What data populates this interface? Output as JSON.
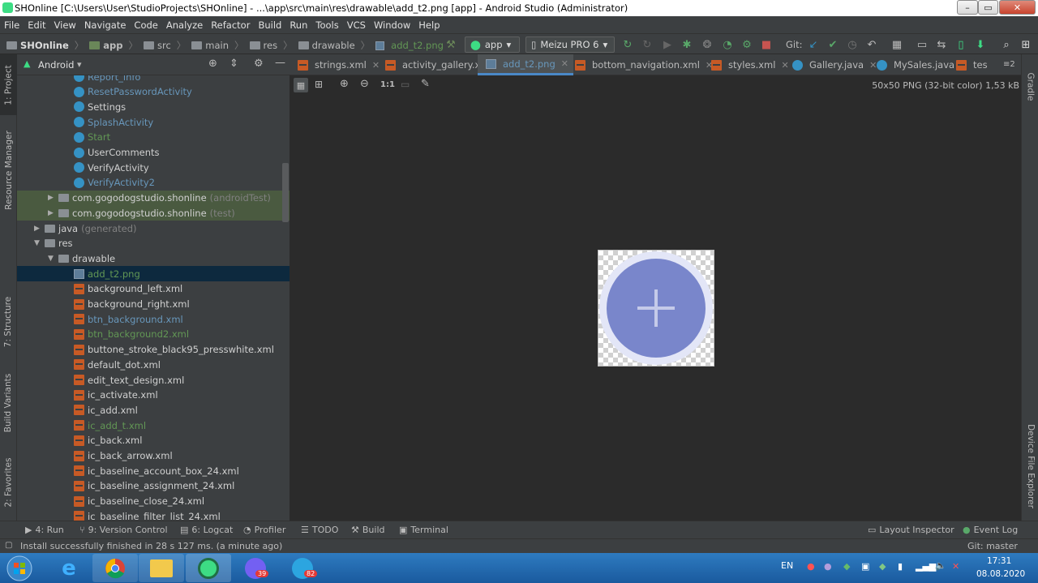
{
  "window": {
    "title": "SHOnline [C:\\Users\\User\\StudioProjects\\SHOnline] - ...\\app\\src\\main\\res\\drawable\\add_t2.png [app] - Android Studio (Administrator)"
  },
  "menu": [
    "File",
    "Edit",
    "View",
    "Navigate",
    "Code",
    "Analyze",
    "Refactor",
    "Build",
    "Run",
    "Tools",
    "VCS",
    "Window",
    "Help"
  ],
  "breadcrumb": [
    "SHOnline",
    "app",
    "src",
    "main",
    "res",
    "drawable",
    "add_t2.png"
  ],
  "toolbar": {
    "run_config": "app",
    "device": "Meizu PRO 6",
    "git_label": "Git:"
  },
  "left_strip": {
    "project": "1: Project",
    "resource_manager": "Resource Manager",
    "structure": "7: Structure",
    "build_variants": "Build Variants",
    "favorites": "2: Favorites"
  },
  "right_strip": {
    "gradle": "Gradle",
    "device_file_explorer": "Device File Explorer"
  },
  "project_panel": {
    "view_mode": "Android"
  },
  "tree": [
    {
      "label": "Report_info",
      "kind": "class",
      "indent": 70,
      "color": "c-blue"
    },
    {
      "label": "ResetPasswordActivity",
      "kind": "class",
      "indent": 70,
      "color": "c-blue"
    },
    {
      "label": "Settings",
      "kind": "class",
      "indent": 70,
      "color": "c-white"
    },
    {
      "label": "SplashActivity",
      "kind": "class",
      "indent": 70,
      "color": "c-blue"
    },
    {
      "label": "Start",
      "kind": "class",
      "indent": 70,
      "color": "c-green"
    },
    {
      "label": "UserComments",
      "kind": "class",
      "indent": 70,
      "color": "c-white"
    },
    {
      "label": "VerifyActivity",
      "kind": "class",
      "indent": 70,
      "color": "c-white"
    },
    {
      "label": "VerifyActivity2",
      "kind": "class",
      "indent": 70,
      "color": "c-blue"
    },
    {
      "label": "com.gogodogstudio.shonline",
      "suffix": "(androidTest)",
      "kind": "package",
      "indent": 36,
      "color": "c-white",
      "arrow": "▶",
      "hl": "green"
    },
    {
      "label": "com.gogodogstudio.shonline",
      "suffix": "(test)",
      "kind": "package",
      "indent": 36,
      "color": "c-white",
      "arrow": "▶",
      "hl": "green"
    },
    {
      "label": "java",
      "suffix": "(generated)",
      "kind": "folder",
      "indent": 19,
      "color": "c-white",
      "arrow": "▶"
    },
    {
      "label": "res",
      "kind": "folder",
      "indent": 19,
      "color": "c-white",
      "arrow": "▼"
    },
    {
      "label": "drawable",
      "kind": "folder",
      "indent": 36,
      "color": "c-white",
      "arrow": "▼"
    },
    {
      "label": "add_t2.png",
      "kind": "png",
      "indent": 70,
      "color": "c-green",
      "hl": "selected"
    },
    {
      "label": "background_left.xml",
      "kind": "xml",
      "indent": 70,
      "color": "c-white"
    },
    {
      "label": "background_right.xml",
      "kind": "xml",
      "indent": 70,
      "color": "c-white"
    },
    {
      "label": "btn_background.xml",
      "kind": "xml",
      "indent": 70,
      "color": "c-blue"
    },
    {
      "label": "btn_background2.xml",
      "kind": "xml",
      "indent": 70,
      "color": "c-green"
    },
    {
      "label": "buttone_stroke_black95_presswhite.xml",
      "kind": "xml",
      "indent": 70,
      "color": "c-white"
    },
    {
      "label": "default_dot.xml",
      "kind": "xml",
      "indent": 70,
      "color": "c-white"
    },
    {
      "label": "edit_text_design.xml",
      "kind": "xml",
      "indent": 70,
      "color": "c-white"
    },
    {
      "label": "ic_activate.xml",
      "kind": "xml",
      "indent": 70,
      "color": "c-white"
    },
    {
      "label": "ic_add.xml",
      "kind": "xml",
      "indent": 70,
      "color": "c-white"
    },
    {
      "label": "ic_add_t.xml",
      "kind": "xml",
      "indent": 70,
      "color": "c-green"
    },
    {
      "label": "ic_back.xml",
      "kind": "xml",
      "indent": 70,
      "color": "c-white"
    },
    {
      "label": "ic_back_arrow.xml",
      "kind": "xml",
      "indent": 70,
      "color": "c-white"
    },
    {
      "label": "ic_baseline_account_box_24.xml",
      "kind": "xml",
      "indent": 70,
      "color": "c-white"
    },
    {
      "label": "ic_baseline_assignment_24.xml",
      "kind": "xml",
      "indent": 70,
      "color": "c-white"
    },
    {
      "label": "ic_baseline_close_24.xml",
      "kind": "xml",
      "indent": 70,
      "color": "c-white"
    },
    {
      "label": "ic_baseline_filter_list_24.xml",
      "kind": "xml",
      "indent": 70,
      "color": "c-white"
    }
  ],
  "editor_tabs": [
    {
      "label": "strings.xml",
      "icon": "xml",
      "active": false
    },
    {
      "label": "activity_gallery.xml",
      "icon": "xml",
      "active": false
    },
    {
      "label": "add_t2.png",
      "icon": "png",
      "active": true
    },
    {
      "label": "bottom_navigation.xml",
      "icon": "xml",
      "active": false
    },
    {
      "label": "styles.xml",
      "icon": "xml",
      "active": false
    },
    {
      "label": "Gallery.java",
      "icon": "class",
      "active": false
    },
    {
      "label": "MySales.java",
      "icon": "class",
      "active": false
    },
    {
      "label": "tes",
      "icon": "xml",
      "active": false
    }
  ],
  "tabs_overflow": "≡2",
  "image_viewer": {
    "zoom_actual": "1:1",
    "info": "50x50 PNG (32-bit color) 1,53 kB"
  },
  "bottom_tools": {
    "run": "4: Run",
    "version_control": "9: Version Control",
    "logcat": "6: Logcat",
    "profiler": "Profiler",
    "todo": "TODO",
    "build": "Build",
    "terminal": "Terminal",
    "layout_inspector": "Layout Inspector",
    "event_log": "Event Log"
  },
  "status": {
    "message": "Install successfully finished in 28 s 127 ms. (a minute ago)",
    "git_branch": "Git: master"
  },
  "taskbar": {
    "language": "EN",
    "time": "17:31",
    "date": "08.08.2020",
    "viber_badge": "39",
    "telegram_badge": "82"
  },
  "colors": {
    "ide_bg": "#2b2b2b",
    "panel_bg": "#3c3f41",
    "selection": "#0d293e",
    "vcs_added": "#629755",
    "vcs_modified": "#6897bb",
    "icon_fill": "#7986cb",
    "icon_ring": "#c5cae9"
  }
}
